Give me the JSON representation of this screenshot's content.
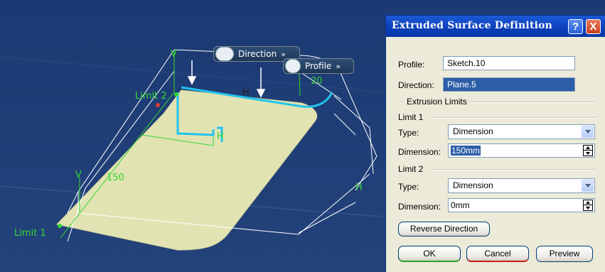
{
  "scene": {
    "manipulators": {
      "direction_label": "Direction",
      "profile_label": "Profile",
      "more_glyph": "»"
    },
    "labels": {
      "limit2": "Limit 2",
      "limit1": "Limit 1",
      "dim_150": "150",
      "dim_20": "20",
      "h_mark": "H",
      "v_mark": "V"
    },
    "colors": {
      "background": "#1f3c73",
      "surface": "#e3e5b6",
      "profile_highlight": "#21c3f0",
      "annotation": "#34d734"
    }
  },
  "dialog": {
    "title": "Extruded Surface Definition",
    "help_glyph": "?",
    "close_glyph": "X",
    "profile_label": "Profile:",
    "profile_value": "Sketch.10",
    "direction_label": "Direction:",
    "direction_value": "Plane.5",
    "extrusion_limits_label": "Extrusion Limits",
    "limit1": {
      "header": "Limit 1",
      "type_label": "Type:",
      "type_value": "Dimension",
      "dimension_label": "Dimension:",
      "dimension_value": "150mm"
    },
    "limit2": {
      "header": "Limit 2",
      "type_label": "Type:",
      "type_value": "Dimension",
      "dimension_label": "Dimension:",
      "dimension_value": "0mm"
    },
    "reverse_direction_label": "Reverse Direction",
    "ok_label": "OK",
    "cancel_label": "Cancel",
    "preview_label": "Preview"
  }
}
